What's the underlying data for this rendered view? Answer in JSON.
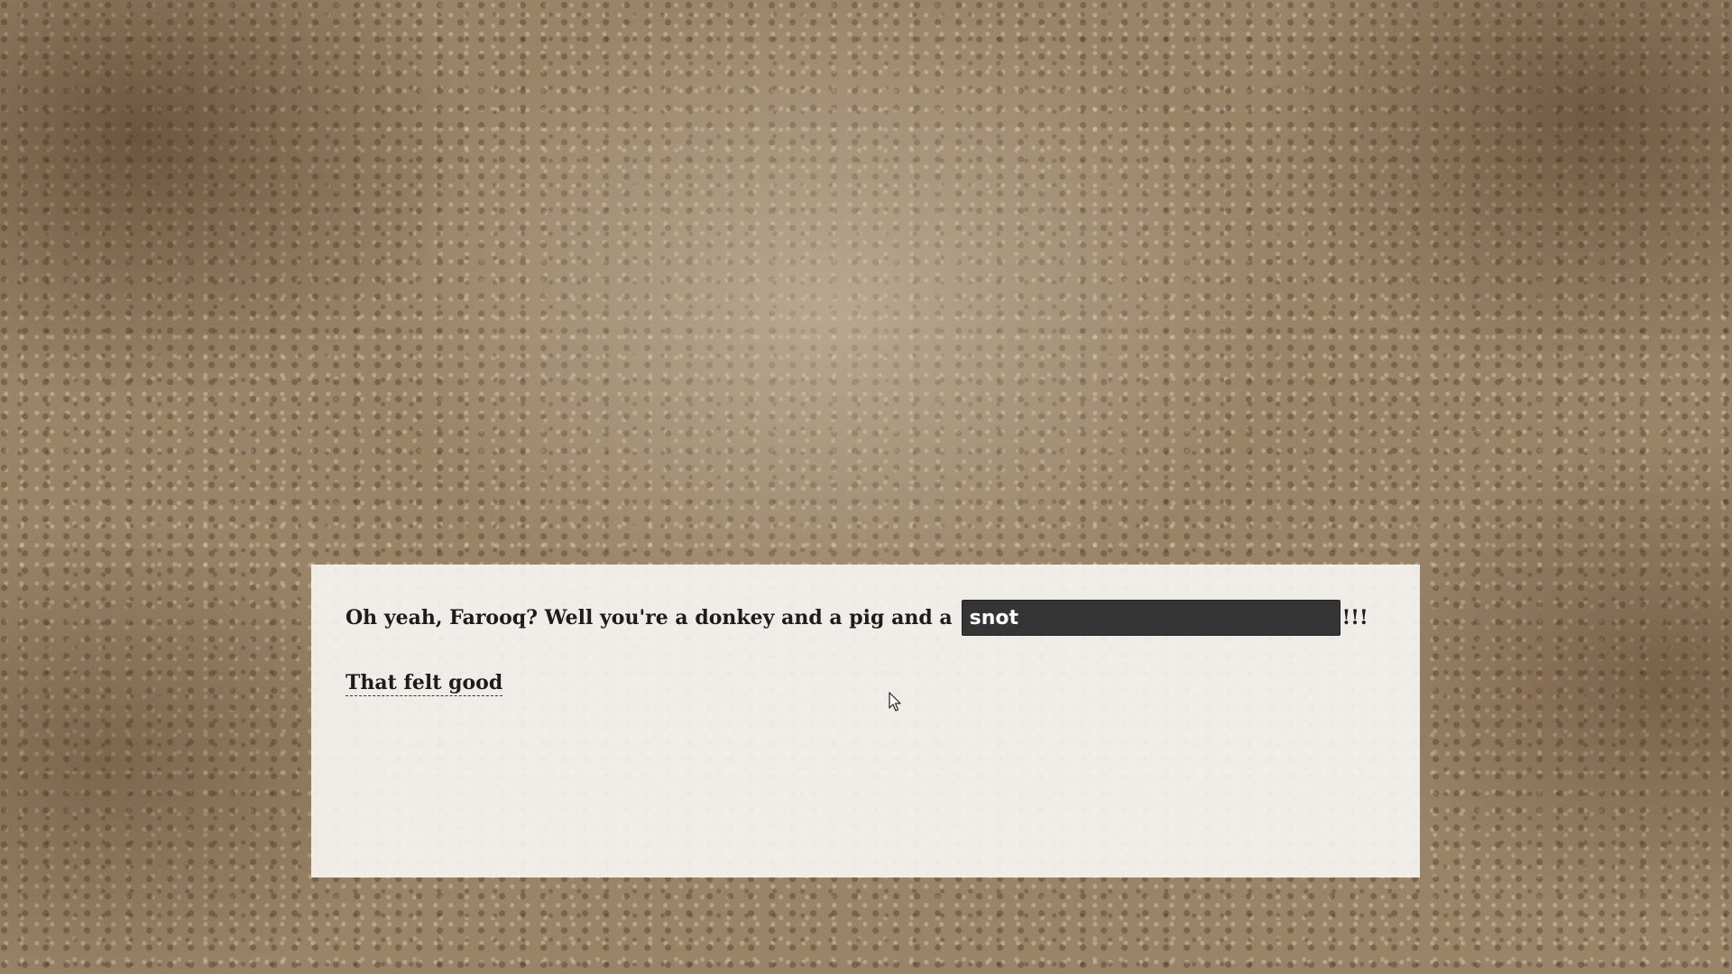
{
  "story": {
    "prompt_text": "Oh yeah, Farooq? Well you're a donkey and a pig and a",
    "answer_value": "snot",
    "suffix_text": "!!!",
    "choice_label": "That felt good"
  },
  "icons": {
    "cursor": "mouse-pointer-icon"
  },
  "colors": {
    "panel_background": "#f6f4f2",
    "input_background": "#353535",
    "input_text": "#ffffff",
    "text": "#1c1c1c"
  }
}
